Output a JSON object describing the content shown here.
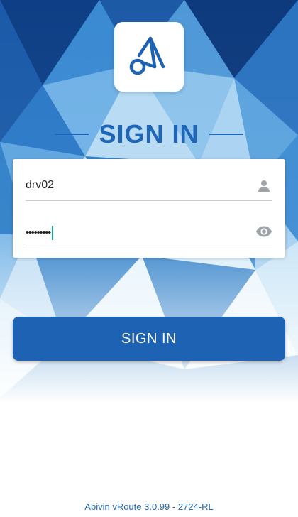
{
  "title": "SIGN IN",
  "form": {
    "username_value": "drv02",
    "password_value": "•••••••••",
    "username_icon": "user-icon",
    "password_icon": "eye-icon"
  },
  "button": {
    "label": "SIGN IN"
  },
  "footer": {
    "version": "Abivin vRoute 3.0.99 - 2724-RL"
  },
  "colors": {
    "accent": "#1f66b8",
    "button": "#1d62b3",
    "caret": "#1aa39a"
  }
}
